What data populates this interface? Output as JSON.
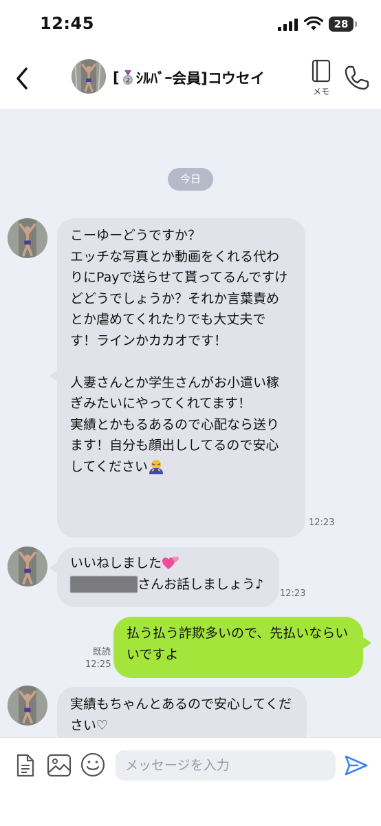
{
  "status_bar": {
    "time": "12:45",
    "battery": "28"
  },
  "header": {
    "name_prefix": "[",
    "name_rest": "ｼﾙﾊﾞｰ会員]コウセイ",
    "memo_label": "メモ"
  },
  "chat": {
    "date_chip": "今日",
    "messages": [
      {
        "text": "こーゆーどうですか？\nエッチな写真とか動画をくれる代わりにPayで送らせて貰ってるんですけどどうでしょうか？それか言葉責めとか虐めてくれたりでも大丈夫です！ラインかカカオです！\n\n人妻さんとか学生さんがお小遣い稼ぎみたいにやってくれてます！\n実績とかもるあるので心配なら送ります！自分も顔出ししてるので安心してください",
        "time": "12:23"
      },
      {
        "text_line1": "いいねしました",
        "text_line2": "さんお話しましょう♪",
        "time": "12:23"
      },
      {
        "text": "払う払う詐欺多いので、先払いならいいですよ",
        "read_label": "既読",
        "time": "12:25"
      },
      {
        "text": "実績もちゃんとあるので安心してください♡"
      }
    ]
  },
  "composer": {
    "placeholder": "メッセージを入力"
  },
  "colors": {
    "background": "#ECEFF5",
    "incoming": "#E2E3EA",
    "outgoing": "#A3E53A",
    "send": "#3B82F6"
  }
}
